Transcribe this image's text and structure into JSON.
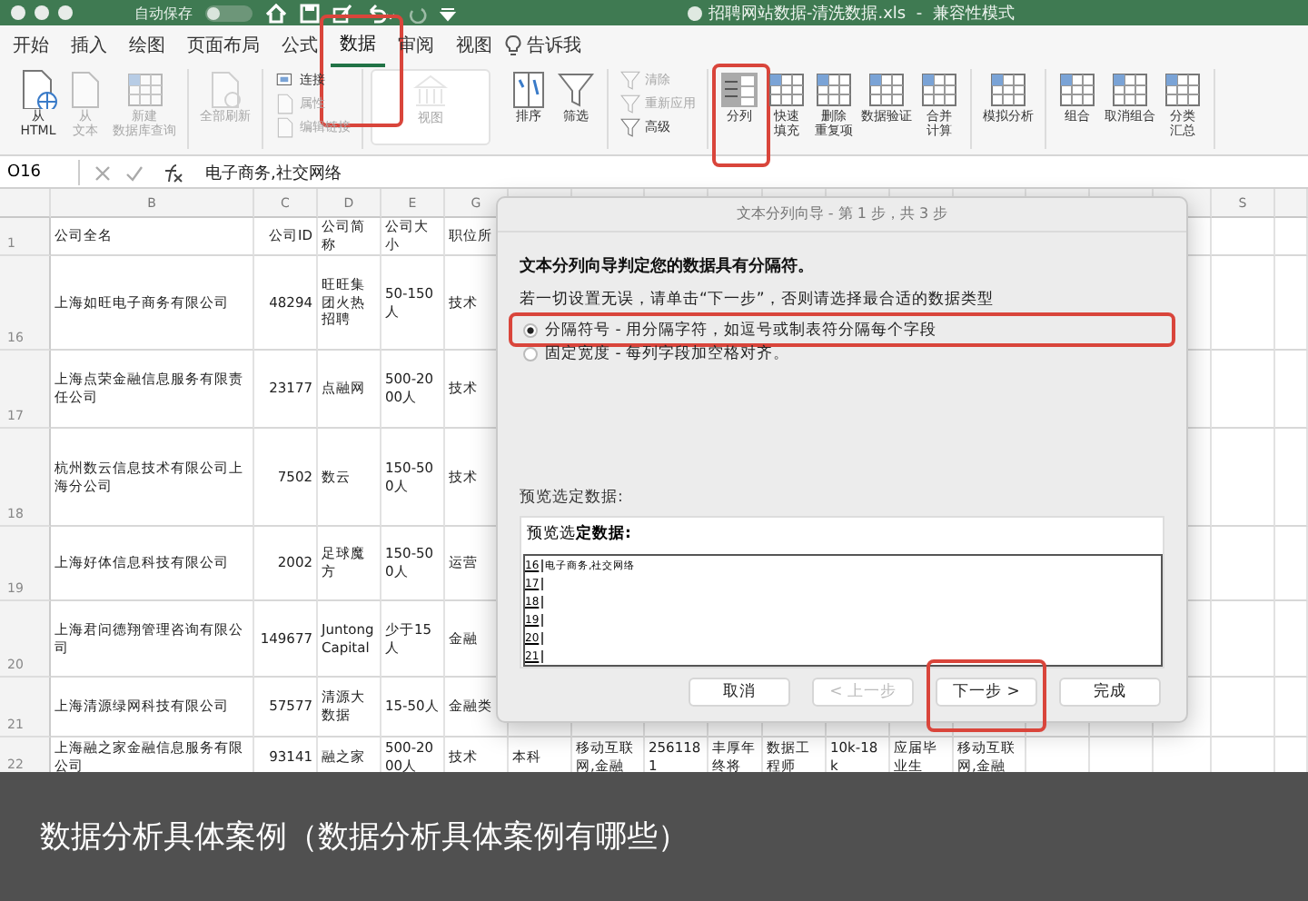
{
  "window": {
    "autosave_label": "自动保存",
    "autosave_on": false,
    "title": "招聘网站数据-清洗数据.xls  -  兼容性模式"
  },
  "tabs": [
    {
      "label": "开始",
      "selected": false,
      "highlighted": false
    },
    {
      "label": "插入",
      "selected": false,
      "highlighted": false
    },
    {
      "label": "绘图",
      "selected": false,
      "highlighted": false
    },
    {
      "label": "页面布局",
      "selected": false,
      "highlighted": false
    },
    {
      "label": "公式",
      "selected": false,
      "highlighted": false
    },
    {
      "label": "数据",
      "selected": true,
      "highlighted": true
    },
    {
      "label": "审阅",
      "selected": false,
      "highlighted": false
    },
    {
      "label": "视图",
      "selected": false,
      "highlighted": false
    }
  ],
  "tell_me": "告诉我",
  "ribbon": [
    {
      "kind": "row",
      "items": [
        {
          "kind": "web",
          "label_lines": [
            "从",
            "HTML"
          ],
          "disabled": false,
          "highlighted": false
        },
        {
          "kind": "doc",
          "label_lines": [
            "从",
            "文本"
          ],
          "disabled": true,
          "highlighted": false
        },
        {
          "kind": "table",
          "label_lines": [
            "新建",
            "数据库查询"
          ],
          "disabled": true,
          "highlighted": false
        }
      ]
    },
    {
      "kind": "row",
      "items": [
        {
          "kind": "refresh",
          "label_lines": [
            "全部刷新"
          ],
          "disabled": true,
          "highlighted": false
        }
      ]
    },
    {
      "kind": "stack",
      "items": [
        {
          "kind": "link",
          "label_lines": [
            "连接"
          ],
          "disabled": false,
          "highlighted": false
        },
        {
          "kind": "doc",
          "label_lines": [
            "属性"
          ],
          "disabled": true,
          "highlighted": false
        },
        {
          "kind": "doc",
          "label_lines": [
            "编辑链接"
          ],
          "disabled": true,
          "highlighted": false
        }
      ]
    },
    {
      "kind": "panel",
      "items": [
        {
          "kind": "bank",
          "label_lines": [
            "视图"
          ],
          "disabled": true,
          "highlighted": false
        }
      ]
    },
    {
      "kind": "row",
      "items": [
        {
          "kind": "sort",
          "label_lines": [
            "排序"
          ],
          "disabled": false,
          "highlighted": false
        },
        {
          "kind": "filter",
          "label_lines": [
            "筛选"
          ],
          "disabled": false,
          "highlighted": false
        }
      ]
    },
    {
      "kind": "stack",
      "items": [
        {
          "kind": "filter",
          "label_lines": [
            "清除"
          ],
          "disabled": true,
          "highlighted": false
        },
        {
          "kind": "filter",
          "label_lines": [
            "重新应用"
          ],
          "disabled": true,
          "highlighted": false
        },
        {
          "kind": "filter",
          "label_lines": [
            "高级"
          ],
          "disabled": false,
          "highlighted": false
        }
      ]
    },
    {
      "kind": "row",
      "items": [
        {
          "kind": "split",
          "label_lines": [
            "分列"
          ],
          "disabled": false,
          "highlighted": true
        },
        {
          "kind": "table",
          "label_lines": [
            "快速",
            "填充"
          ],
          "disabled": false,
          "highlighted": false
        },
        {
          "kind": "table",
          "label_lines": [
            "删除",
            "重复项"
          ],
          "disabled": false,
          "highlighted": false
        },
        {
          "kind": "table",
          "label_lines": [
            "数据验证"
          ],
          "disabled": false,
          "highlighted": false
        },
        {
          "kind": "table",
          "label_lines": [
            "合并",
            "计算"
          ],
          "disabled": false,
          "highlighted": false
        }
      ]
    },
    {
      "kind": "row",
      "items": [
        {
          "kind": "table",
          "label_lines": [
            "模拟分析"
          ],
          "disabled": false,
          "highlighted": false
        }
      ]
    },
    {
      "kind": "row",
      "items": [
        {
          "kind": "table",
          "label_lines": [
            "组合"
          ],
          "disabled": false,
          "highlighted": false
        },
        {
          "kind": "table",
          "label_lines": [
            "取消组合"
          ],
          "disabled": false,
          "highlighted": false
        },
        {
          "kind": "table",
          "label_lines": [
            "分类",
            "汇总"
          ],
          "disabled": false,
          "highlighted": false
        }
      ]
    }
  ],
  "formula_bar": {
    "cell": "O16",
    "formula": "电子商务,社交网络"
  },
  "sheet": {
    "columns": [
      "B",
      "C",
      "D",
      "E",
      "G",
      "",
      "",
      "",
      "",
      "",
      "",
      "",
      "",
      "",
      "",
      "",
      "S",
      ""
    ],
    "rows": [
      {
        "number": "1",
        "cells": [
          "公司全名",
          "公司ID",
          "公司简称",
          "公司大小",
          "职位所"
        ]
      },
      {
        "number": "16",
        "cells": [
          "上海如旺电子商务有限公司",
          "48294",
          "旺旺集团火热招聘",
          "50-150人",
          "技术"
        ]
      },
      {
        "number": "17",
        "cells": [
          "上海点荣金融信息服务有限责任公司",
          "23177",
          "点融网",
          "500-2000人",
          "技术"
        ]
      },
      {
        "number": "18",
        "cells": [
          "杭州数云信息技术有限公司上海分公司",
          "7502",
          "数云",
          "150-500人",
          "技术"
        ]
      },
      {
        "number": "19",
        "cells": [
          "上海好体信息科技有限公司",
          "2002",
          "足球魔方",
          "150-500人",
          "运营"
        ]
      },
      {
        "number": "20",
        "cells": [
          "上海君问德翔管理咨询有限公司",
          "149677",
          "Juntong Capital",
          "少于15人",
          "金融"
        ]
      },
      {
        "number": "21",
        "cells": [
          "上海清源绿网科技有限公司",
          "57577",
          "清源大数据",
          "15-50人",
          "金融类"
        ]
      },
      {
        "number": "22",
        "cells": [
          "上海融之家金融信息服务有限公司",
          "93141",
          "融之家",
          "500-2000人",
          "技术",
          "本科",
          "移动互联网,金融",
          "2561181",
          "丰厚年终将",
          "数据工程师",
          "10k-18k",
          "应届毕业生",
          "移动互联网,金融"
        ]
      }
    ]
  },
  "dialog": {
    "title": "文本分列向导 - 第 1 步，共 3 步",
    "heading": "文本分列向导判定您的数据具有分隔符。",
    "instruction": "若一切设置无误，请单击“下一步”，否则请选择最合适的数据类型",
    "options": [
      {
        "label": "分隔符号 - 用分隔字符，如逗号或制表符分隔每个字段",
        "selected": true,
        "highlighted": true
      },
      {
        "label": "固定宽度 - 每列字段加空格对齐。",
        "selected": false,
        "highlighted": false
      }
    ],
    "preview_label": "预览选定数据:",
    "preview_header": "预览选**定数据:**",
    "preview_rows": [
      {
        "number": "16",
        "text": "电子商务,社交网络"
      },
      {
        "number": "17",
        "text": ""
      },
      {
        "number": "18",
        "text": ""
      },
      {
        "number": "19",
        "text": ""
      },
      {
        "number": "20",
        "text": ""
      },
      {
        "number": "21",
        "text": ""
      }
    ],
    "buttons": [
      {
        "label": "取消",
        "disabled": false,
        "highlighted": false
      },
      {
        "label": "< 上一步",
        "disabled": true,
        "highlighted": false
      },
      {
        "label": "下一步 >",
        "disabled": false,
        "highlighted": true
      },
      {
        "label": "完成",
        "disabled": false,
        "highlighted": false
      }
    ]
  },
  "caption": "数据分析具体案例（数据分析具体案例有哪些）"
}
